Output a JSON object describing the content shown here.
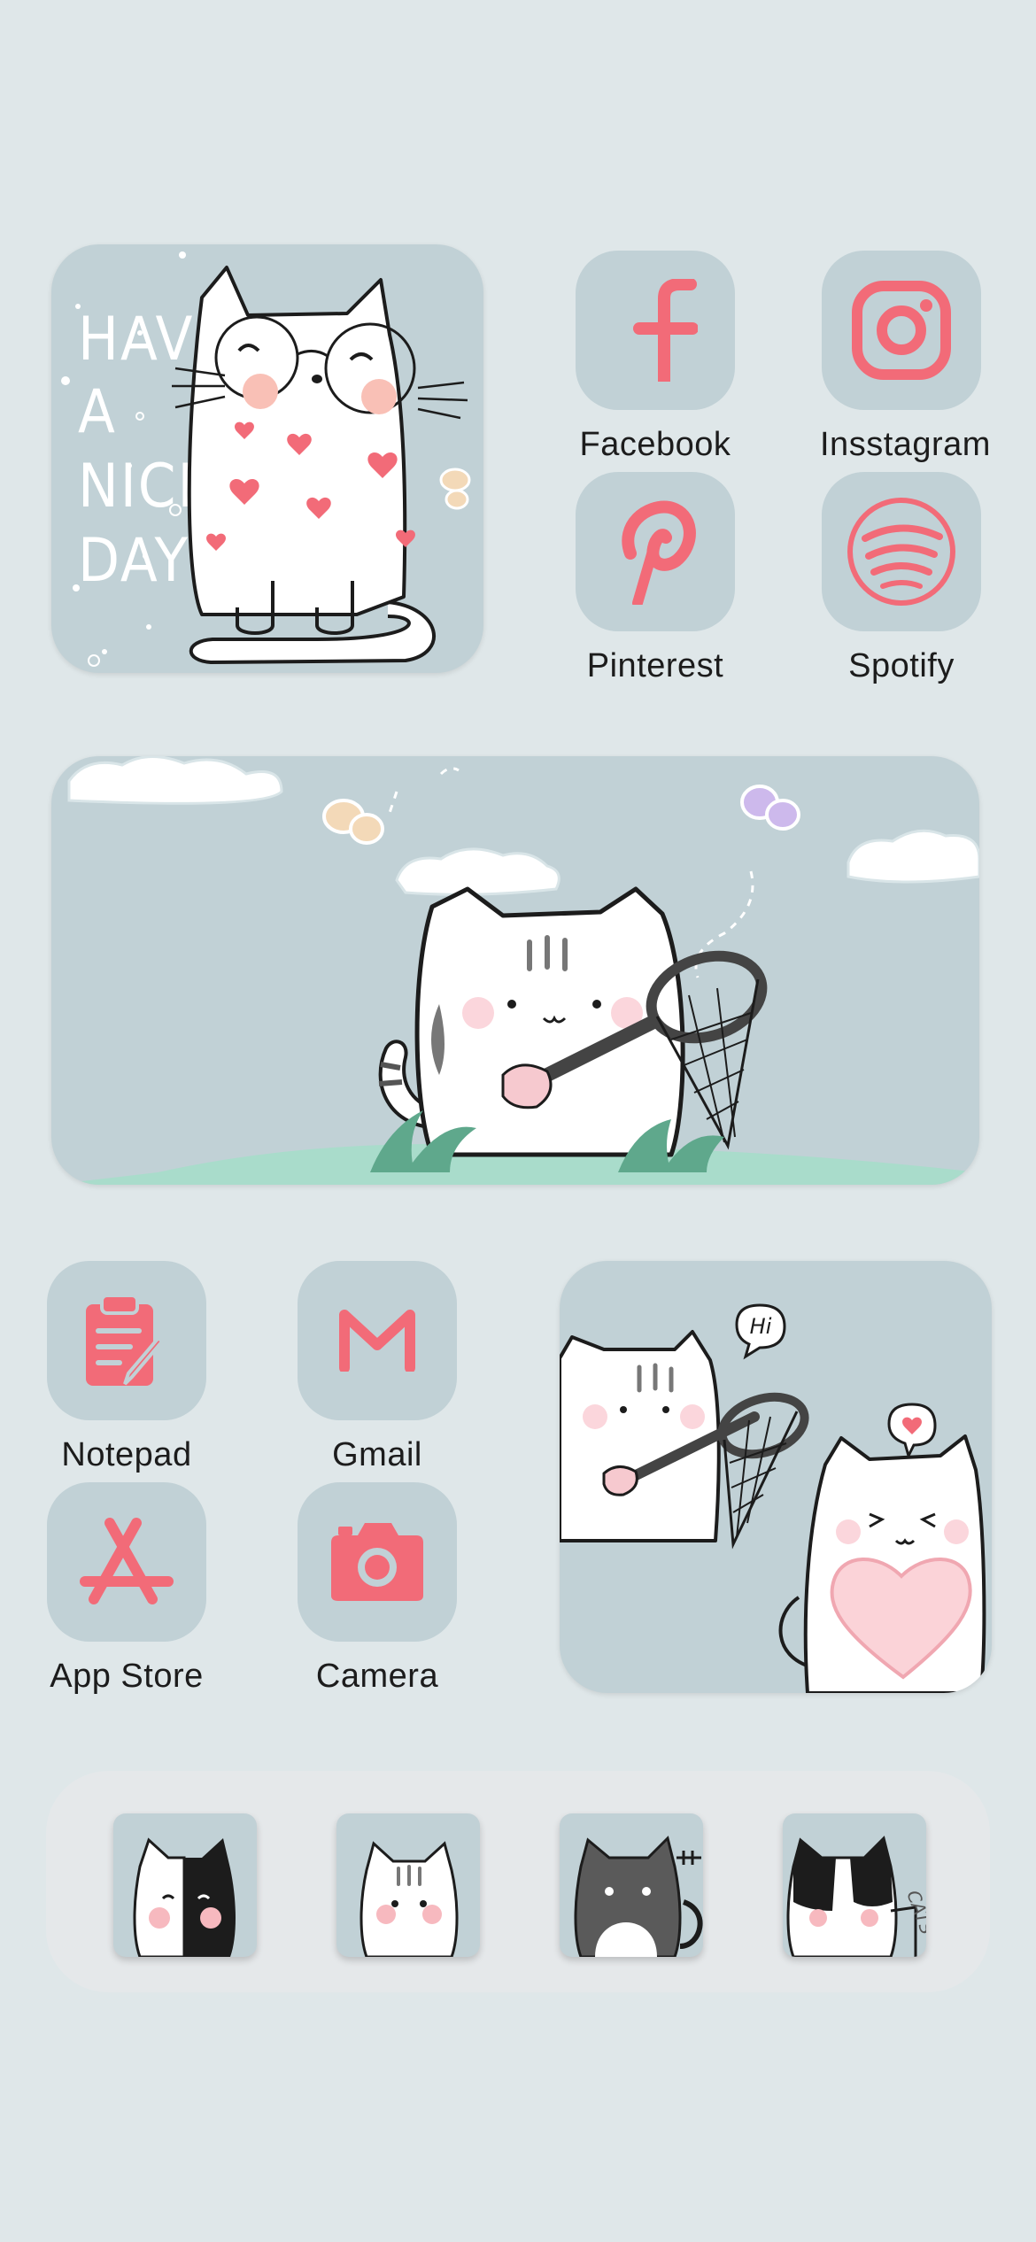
{
  "widgets": {
    "have_nice_day": {
      "text": "HAVE\nA\nNICE\nDAY"
    },
    "butterfly_net": {},
    "two_cats": {
      "speech": "Hi"
    }
  },
  "apps": {
    "facebook": {
      "label": "Facebook",
      "icon": "facebook-icon"
    },
    "instagram": {
      "label": "Insstagram",
      "icon": "instagram-icon"
    },
    "pinterest": {
      "label": "Pinterest",
      "icon": "pinterest-icon"
    },
    "spotify": {
      "label": "Spotify",
      "icon": "spotify-icon"
    },
    "notepad": {
      "label": "Notepad",
      "icon": "notepad-icon"
    },
    "gmail": {
      "label": "Gmail",
      "icon": "gmail-icon"
    },
    "appstore": {
      "label": "App Store",
      "icon": "app-store-icon"
    },
    "camera": {
      "label": "Camera",
      "icon": "camera-icon"
    }
  },
  "dock": {
    "items": [
      {
        "icon": "black-white-cat-icon"
      },
      {
        "icon": "tabby-cat-icon"
      },
      {
        "icon": "grey-cat-icon"
      },
      {
        "icon": "tuxedo-cat-icon"
      }
    ],
    "cats_text": "CATS"
  },
  "colors": {
    "background": "#dfe7e9",
    "tile": "#c1d1d6",
    "accent": "#f26b78",
    "dock": "#e5e8ea"
  }
}
